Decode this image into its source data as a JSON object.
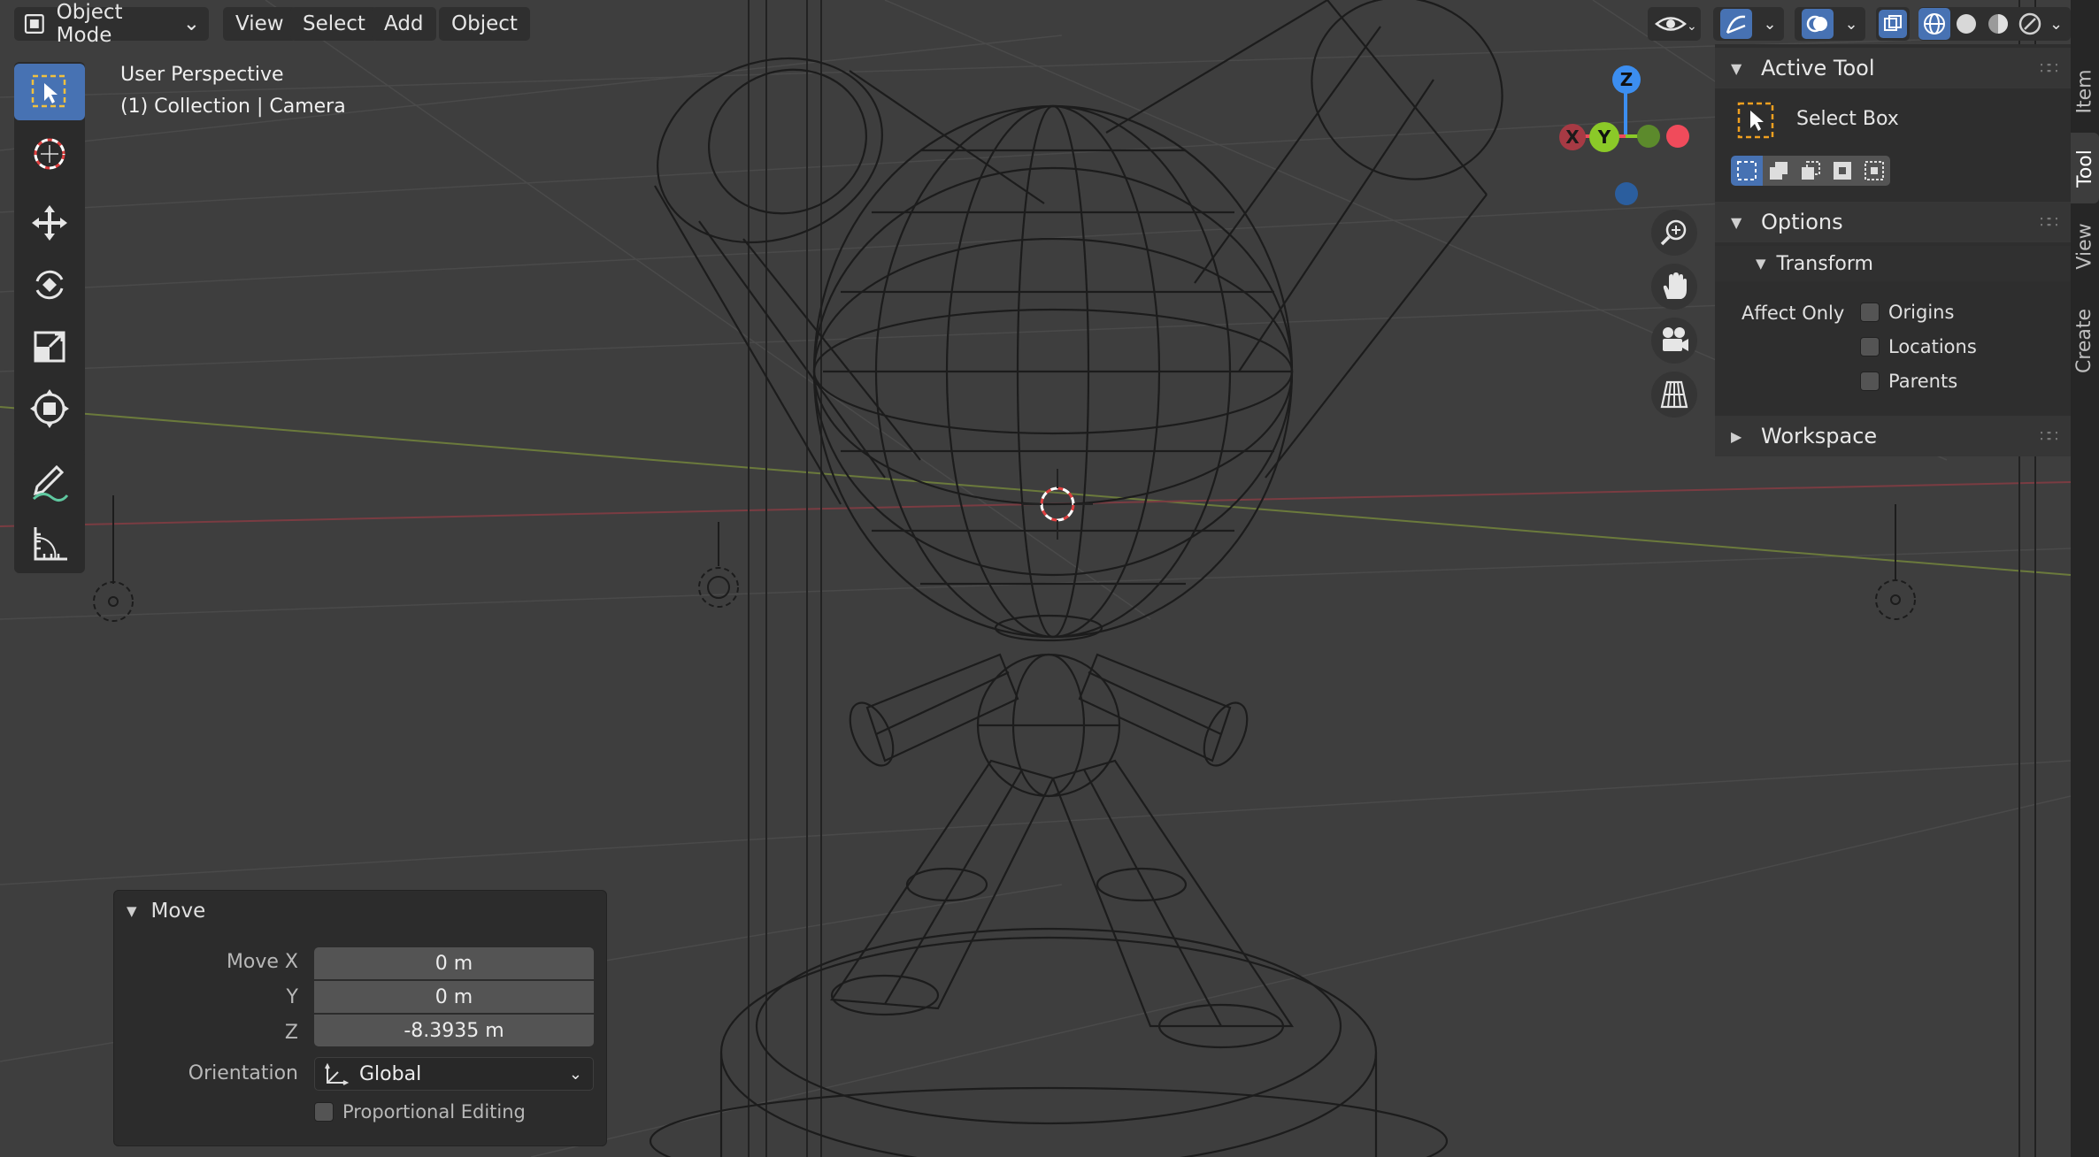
{
  "header": {
    "mode_label": "Object Mode",
    "menus": [
      "View",
      "Select",
      "Add",
      "Object"
    ]
  },
  "viewport": {
    "perspective_label": "User Perspective",
    "collection_label": "(1) Collection | Camera"
  },
  "gizmo": {
    "z_label": "Z",
    "y_label": "Y",
    "x_label": "X",
    "x_color": "#f04b5b",
    "y_color": "#8bc928",
    "z_color": "#3c8ef0"
  },
  "toolbar": {
    "tools": [
      "select-box",
      "cursor",
      "move",
      "rotate",
      "scale",
      "transform",
      "annotate",
      "measure"
    ]
  },
  "sidebar": {
    "active_tool_header": "Active Tool",
    "active_tool_name": "Select Box",
    "options_header": "Options",
    "transform_header": "Transform",
    "affect_only_label": "Affect Only",
    "affect_only": [
      {
        "label": "Origins",
        "checked": false
      },
      {
        "label": "Locations",
        "checked": false
      },
      {
        "label": "Parents",
        "checked": false
      }
    ],
    "workspace_header": "Workspace"
  },
  "tabs": [
    "Item",
    "Tool",
    "View",
    "Create"
  ],
  "operator": {
    "title": "Move",
    "move_x_label": "Move X",
    "move_x": "0 m",
    "y_label": "Y",
    "y_value": "0 m",
    "z_label": "Z",
    "z_value": "-8.3935 m",
    "orientation_label": "Orientation",
    "orientation_value": "Global",
    "proportional_label": "Proportional Editing",
    "proportional_checked": false
  },
  "colors": {
    "accent": "#4772b3",
    "viewport_bg": "#3e3e3e",
    "panel_bg": "#2e2e2e"
  }
}
